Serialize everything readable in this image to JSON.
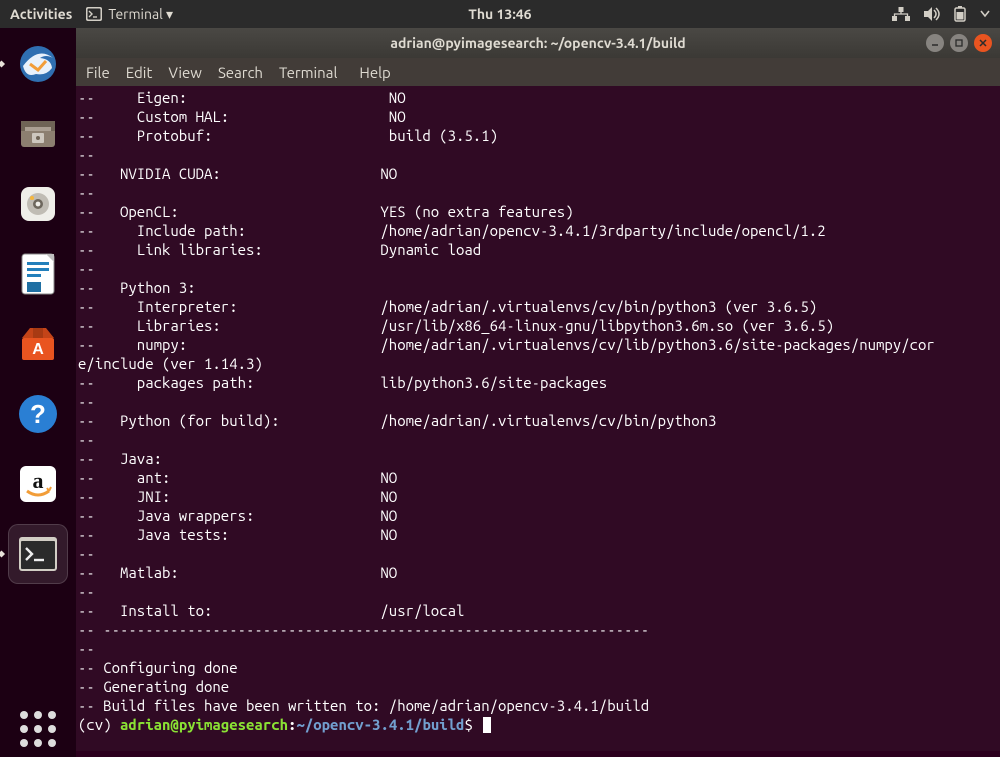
{
  "topbar": {
    "activities": "Activities",
    "terminal_label": "Terminal ▾",
    "clock": "Thu 13:46"
  },
  "dock": {
    "apps": [
      {
        "name": "thunderbird",
        "letter": "",
        "bg": "#2f6fb1",
        "ind": true
      },
      {
        "name": "files",
        "letter": "",
        "bg": "#9a8d80",
        "ind": false
      },
      {
        "name": "rhythmbox",
        "letter": "",
        "bg": "#efeee9",
        "ind": false
      },
      {
        "name": "libreoffice",
        "letter": "",
        "bg": "#227fbb",
        "ind": false
      },
      {
        "name": "software",
        "letter": "A",
        "bg": "#e95420",
        "ind": false
      },
      {
        "name": "help",
        "letter": "?",
        "bg": "#2a7fd4",
        "ind": false
      },
      {
        "name": "amazon",
        "letter": "a",
        "bg": "#ffffff",
        "ind": false
      },
      {
        "name": "terminal",
        "letter": ">_",
        "bg": "#2b2b2b",
        "ind": true,
        "selected": true
      }
    ]
  },
  "window": {
    "title": "adrian@pyimagesearch: ~/opencv-3.4.1/build",
    "menus": [
      "File",
      "Edit",
      "View",
      "Search",
      "Terminal",
      "Help"
    ]
  },
  "terminal": {
    "lines": [
      "--     Eigen:                        NO",
      "--     Custom HAL:                   NO",
      "--     Protobuf:                     build (3.5.1)",
      "--",
      "--   NVIDIA CUDA:                   NO",
      "--",
      "--   OpenCL:                        YES (no extra features)",
      "--     Include path:                /home/adrian/opencv-3.4.1/3rdparty/include/opencl/1.2",
      "--     Link libraries:              Dynamic load",
      "--",
      "--   Python 3:",
      "--     Interpreter:                 /home/adrian/.virtualenvs/cv/bin/python3 (ver 3.6.5)",
      "--     Libraries:                   /usr/lib/x86_64-linux-gnu/libpython3.6m.so (ver 3.6.5)",
      "--     numpy:                       /home/adrian/.virtualenvs/cv/lib/python3.6/site-packages/numpy/cor",
      "e/include (ver 1.14.3)",
      "--     packages path:               lib/python3.6/site-packages",
      "--",
      "--   Python (for build):            /home/adrian/.virtualenvs/cv/bin/python3",
      "--",
      "--   Java:",
      "--     ant:                         NO",
      "--     JNI:                         NO",
      "--     Java wrappers:               NO",
      "--     Java tests:                  NO",
      "--",
      "--   Matlab:                        NO",
      "--",
      "--   Install to:                    /usr/local",
      "-- -----------------------------------------------------------------",
      "--",
      "-- Configuring done",
      "-- Generating done",
      "-- Build files have been written to: /home/adrian/opencv-3.4.1/build"
    ],
    "prompt": {
      "env": "(cv) ",
      "user": "adrian@pyimagesearch",
      "colon": ":",
      "path": "~/opencv-3.4.1/build",
      "dollar": "$ "
    }
  }
}
